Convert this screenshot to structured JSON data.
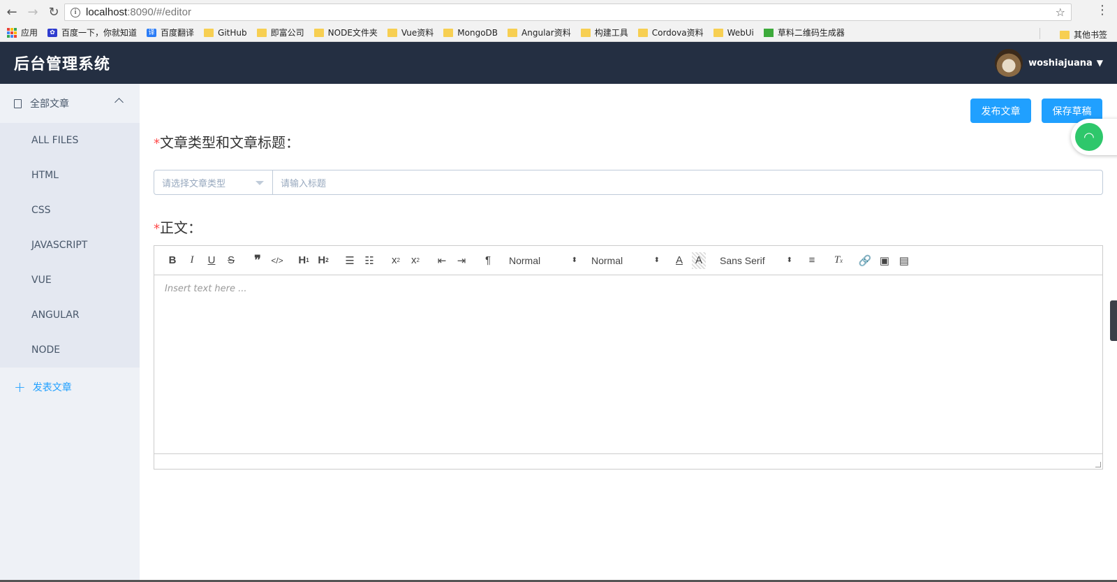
{
  "browser": {
    "url_host": "localhost",
    "url_rest": ":8090/#/editor",
    "bookmarks": [
      {
        "label": "应用",
        "icon": "apps-icon"
      },
      {
        "label": "百度一下，你就知道",
        "icon": "baidu-icon"
      },
      {
        "label": "百度翻译",
        "icon": "translate-icon"
      },
      {
        "label": "GitHub",
        "icon": "folder-icon"
      },
      {
        "label": "即富公司",
        "icon": "folder-icon"
      },
      {
        "label": "NODE文件夹",
        "icon": "folder-icon"
      },
      {
        "label": "Vue资料",
        "icon": "folder-icon"
      },
      {
        "label": "MongoDB",
        "icon": "folder-icon"
      },
      {
        "label": "Angular资料",
        "icon": "folder-icon"
      },
      {
        "label": "构建工具",
        "icon": "folder-icon"
      },
      {
        "label": "Cordova资料",
        "icon": "folder-icon"
      },
      {
        "label": "WebUi",
        "icon": "folder-icon"
      },
      {
        "label": "草料二维码生成器",
        "icon": "qrcode-icon"
      }
    ],
    "other_bookmarks": "其他书签"
  },
  "header": {
    "title": "后台管理系统",
    "username": "woshiajuana"
  },
  "sidebar": {
    "menu_title": "全部文章",
    "items": [
      "ALL FILES",
      "HTML",
      "CSS",
      "JAVASCRIPT",
      "VUE",
      "ANGULAR",
      "NODE"
    ],
    "publish_label": "发表文章"
  },
  "main": {
    "publish_button": "发布文章",
    "draft_button": "保存草稿",
    "required_mark": "*",
    "type_title_label": "文章类型和文章标题：",
    "type_placeholder": "请选择文章类型",
    "title_placeholder": "请输入标题",
    "body_label": "正文：",
    "editor": {
      "header_select": "Normal",
      "size_select": "Normal",
      "font_select": "Sans Serif",
      "placeholder": "Insert text here ..."
    }
  },
  "colors": {
    "header_bg": "#242f42",
    "accent": "#20a0ff",
    "sidebar_bg": "#eef1f6",
    "required": "#ff4949"
  }
}
